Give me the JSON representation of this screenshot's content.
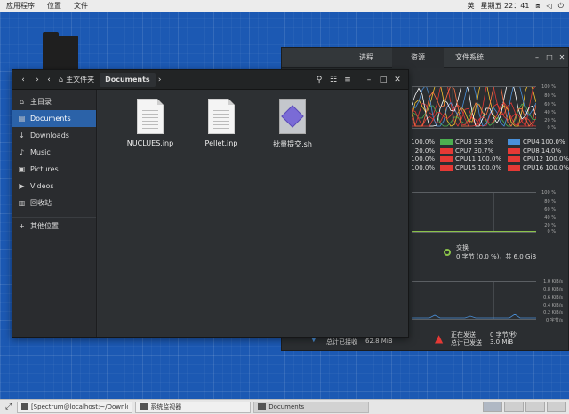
{
  "topbar": {
    "menus": [
      "应用程序",
      "位置",
      "文件"
    ],
    "ime": "英",
    "datetime": "星期五 22：41",
    "icons": [
      "network-icon",
      "volume-icon",
      "power-icon"
    ]
  },
  "sysmon": {
    "tabs": [
      "进程",
      "资源",
      "文件系统"
    ],
    "active_tab": "资源",
    "cpu_rows": [
      [
        {
          "label": "100.0%",
          "color": "",
          "clip": true
        },
        {
          "label": "CPU3 33.3%",
          "color": "#4caf50"
        },
        {
          "label": "CPU4 100.0%",
          "color": "#4a90d9"
        }
      ],
      [
        {
          "label": "20.0%",
          "color": "",
          "clip": true
        },
        {
          "label": "CPU7 30.7%",
          "color": "#e53935"
        },
        {
          "label": "CPU8 14.0%",
          "color": "#e53935"
        }
      ],
      [
        {
          "label": "100.0%",
          "color": "",
          "clip": true
        },
        {
          "label": "CPU11 100.0%",
          "color": "#e53935"
        },
        {
          "label": "CPU12 100.0%",
          "color": "#e53935"
        }
      ],
      [
        {
          "label": "100.0%",
          "color": "",
          "clip": true
        },
        {
          "label": "CPU15 100.0%",
          "color": "#e53935"
        },
        {
          "label": "CPU16 100.0%",
          "color": "#e53935"
        }
      ]
    ],
    "cpu_axis": [
      "100 %",
      "80 %",
      "60 %",
      "40 %",
      "20 %",
      "0 %"
    ],
    "mem_axis": [
      "100 %",
      "80 %",
      "60 %",
      "40 %",
      "20 %",
      "0 %"
    ],
    "net_axis": [
      "1.0 KiB/s",
      "0.8 KiB/s",
      "0.6 KiB/s",
      "0.4 KiB/s",
      "0.2 KiB/s",
      "0 字节/s"
    ],
    "swap": {
      "title": "交换",
      "detail": "0 字节 (0.0 %)，共 6.0 GiB"
    },
    "net": {
      "recv_label": "总计已接收",
      "recv_value": "62.8 MiB",
      "send_rate_label": "正在发送",
      "send_rate_value": "0 字节/秒",
      "send_label": "总计已发送",
      "send_value": "3.0 MiB"
    }
  },
  "fm": {
    "crumbs": [
      "主文件夹",
      "Documents"
    ],
    "sidebar": [
      {
        "icon": "home-icon",
        "glyph": "⌂",
        "label": "主目录",
        "active": false
      },
      {
        "icon": "documents-icon",
        "glyph": "▤",
        "label": "Documents",
        "active": true
      },
      {
        "icon": "downloads-icon",
        "glyph": "↓",
        "label": "Downloads",
        "active": false
      },
      {
        "icon": "music-icon",
        "glyph": "♪",
        "label": "Music",
        "active": false
      },
      {
        "icon": "pictures-icon",
        "glyph": "▣",
        "label": "Pictures",
        "active": false
      },
      {
        "icon": "videos-icon",
        "glyph": "▶",
        "label": "Videos",
        "active": false
      },
      {
        "icon": "trash-icon",
        "glyph": "▥",
        "label": "回收站",
        "active": false
      },
      {
        "icon": "plus-icon",
        "glyph": "+",
        "label": "其他位置",
        "active": false,
        "sep": true
      }
    ],
    "files": [
      {
        "name": "NUCLUES.inp",
        "kind": "doc"
      },
      {
        "name": "Pellet.inp",
        "kind": "doc"
      },
      {
        "name": "批量提交.sh",
        "kind": "sh"
      }
    ]
  },
  "taskbar": {
    "items": [
      {
        "label": "[Spectrum@localhost:~/Downloads]",
        "active": false
      },
      {
        "label": "系统监视器",
        "active": false
      },
      {
        "label": "Documents",
        "active": true
      }
    ]
  }
}
